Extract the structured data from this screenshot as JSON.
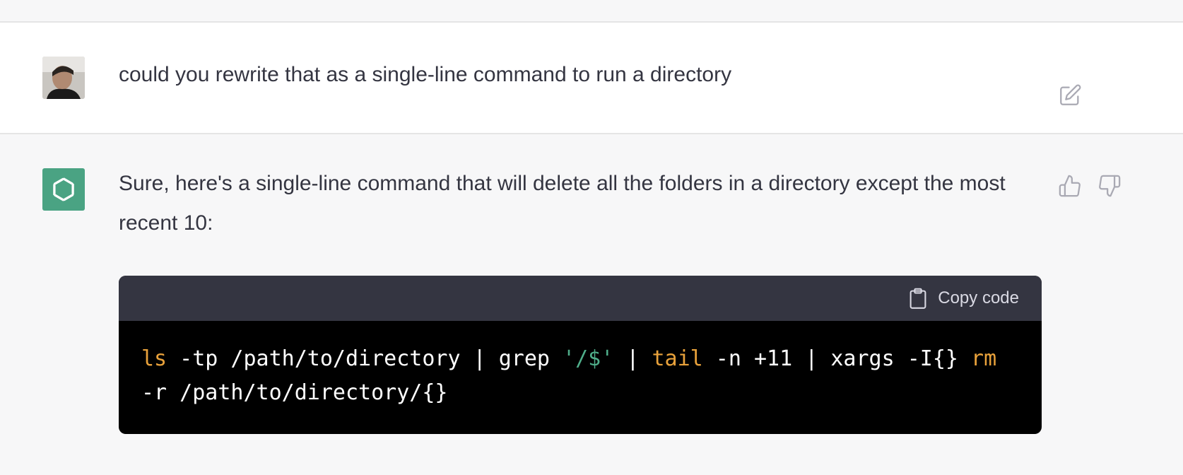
{
  "user_message": {
    "text": "could you rewrite that as a single-line command to run a directory",
    "edit_icon": "edit-icon"
  },
  "assistant_message": {
    "text": "Sure, here's a single-line command that will delete all the folders in a directory except the most recent 10:",
    "feedback": {
      "up_icon": "thumbs-up-icon",
      "down_icon": "thumbs-down-icon"
    },
    "code": {
      "copy_label": "Copy code",
      "tokens": [
        {
          "t": "ls",
          "c": "kw"
        },
        {
          "t": " -tp /path/to/directory | grep ",
          "c": ""
        },
        {
          "t": "'/$'",
          "c": "str"
        },
        {
          "t": " | ",
          "c": ""
        },
        {
          "t": "tail",
          "c": "kw"
        },
        {
          "t": " -n +11 | xargs -I{} ",
          "c": ""
        },
        {
          "t": "rm",
          "c": "kw"
        },
        {
          "t": " -r /path/to/directory/{}",
          "c": ""
        }
      ]
    }
  },
  "colors": {
    "keyword": "#e9a23b",
    "string": "#4fae8a",
    "code_bg": "#000000",
    "code_header_bg": "#343541",
    "assistant_avatar": "#4aa383"
  }
}
